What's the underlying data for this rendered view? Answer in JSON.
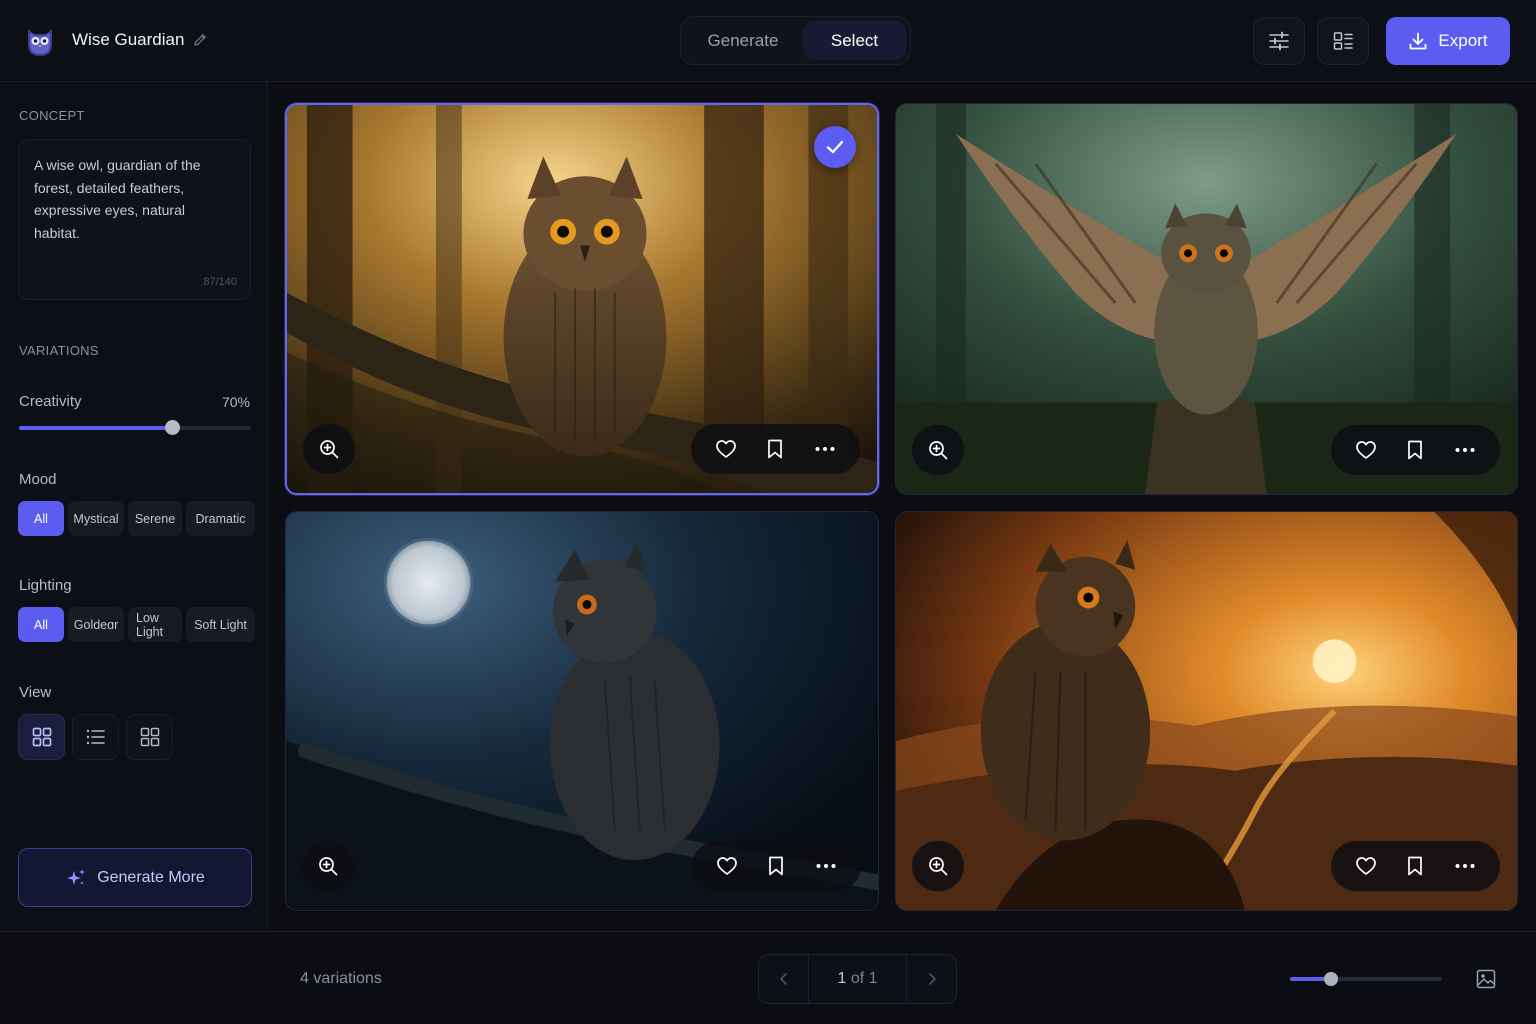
{
  "header": {
    "project_name": "Wise Guardian",
    "tabs": [
      {
        "label": "Generate",
        "active": false
      },
      {
        "label": "Select",
        "active": true
      }
    ],
    "export_label": "Export",
    "logo_icon": "owl-logo-icon",
    "accent_color": "#5b5cf0"
  },
  "sidebar": {
    "concept_label": "CONCEPT",
    "concept_text": "A wise owl, guardian of the forest, detailed feathers, expressive eyes, natural habitat.",
    "char_count": "87/140",
    "variations_label": "VARIATIONS",
    "creativity_label": "Creativity",
    "creativity_value": "70%",
    "creativity_level": 0.66,
    "mood_label": "Mood",
    "mood_options": [
      "All",
      "Mystical",
      "Serene",
      "Dramatic"
    ],
    "mood_selected": "All",
    "lighting_label": "Lighting",
    "lighting_options": [
      "All",
      "Goldeɑr",
      "Low Light",
      "Soft Light"
    ],
    "lighting_selected": "All",
    "view_label": "View",
    "view_options": [
      "grid-view-icon",
      "list-view-icon",
      "tile-view-icon"
    ],
    "view_selected": "grid-view-icon",
    "generate_more_label": "Generate More"
  },
  "grid": {
    "cards": [
      {
        "name": "owl-forest-branch",
        "selected": true
      },
      {
        "name": "owl-wings-spread",
        "selected": false
      },
      {
        "name": "owl-moonlight",
        "selected": false
      },
      {
        "name": "owl-sunset-valley",
        "selected": false
      }
    ]
  },
  "footer": {
    "variations_count": "4 variations",
    "page_current": "1",
    "page_sep": "of 1",
    "zoom_level": 0.27
  }
}
